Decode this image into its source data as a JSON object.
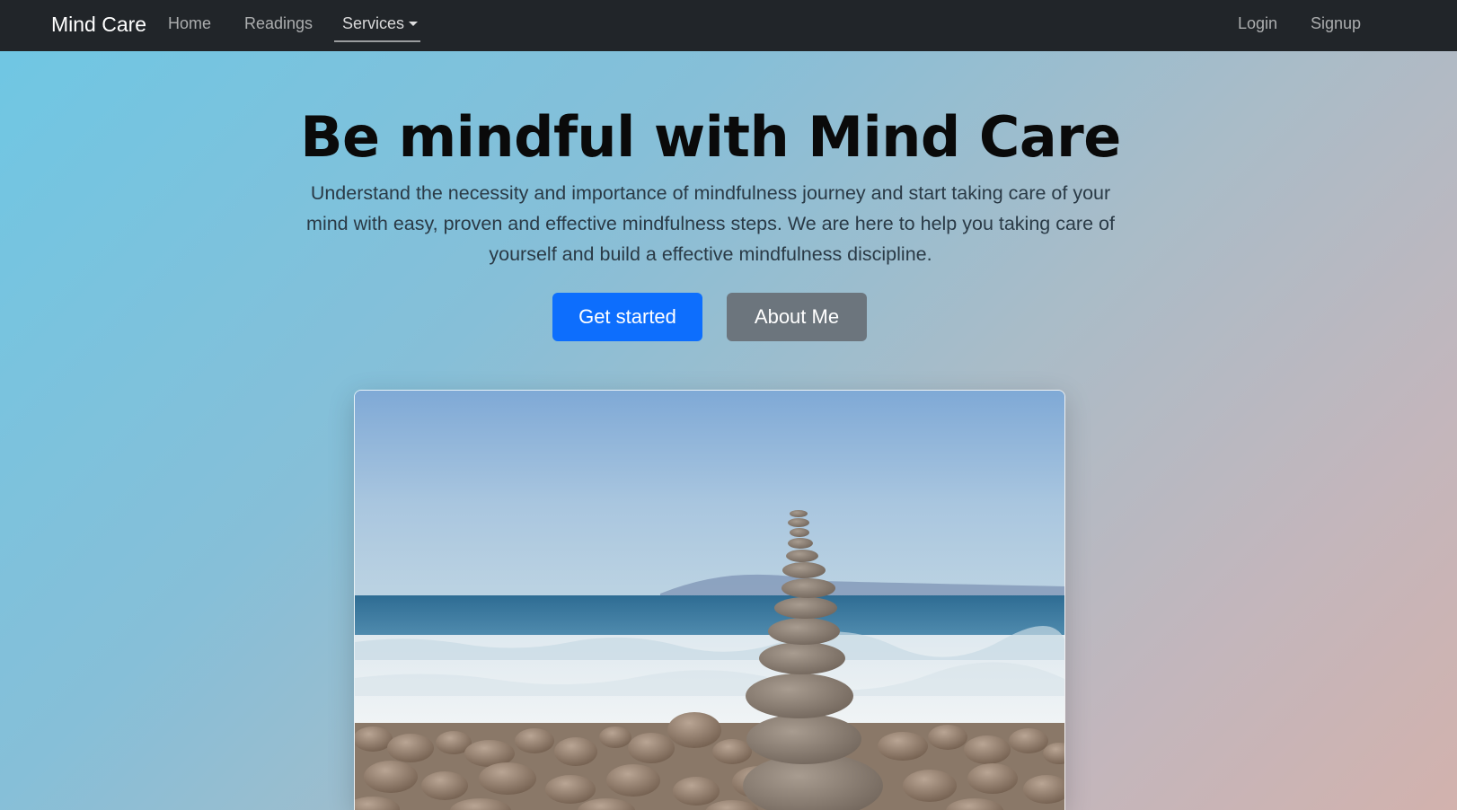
{
  "navbar": {
    "brand": "Mind Care",
    "items": [
      {
        "label": "Home"
      },
      {
        "label": "Readings"
      },
      {
        "label": "Services"
      }
    ],
    "right_items": [
      {
        "label": "Login"
      },
      {
        "label": "Signup"
      }
    ]
  },
  "hero": {
    "title": "Be mindful with Mind Care",
    "lead": "Understand the necessity and importance of mindfulness journey and start taking care of your mind with easy, proven and effective mindfulness steps. We are here to help you taking care of yourself and build a effective mindfulness discipline.",
    "buttons": {
      "primary_label": "Get started",
      "secondary_label": "About Me"
    }
  },
  "colors": {
    "navbar_bg": "#212529",
    "primary": "#0d6efd",
    "secondary": "#6c757d"
  },
  "icons": {
    "services_dropdown": "caret-down-icon"
  }
}
